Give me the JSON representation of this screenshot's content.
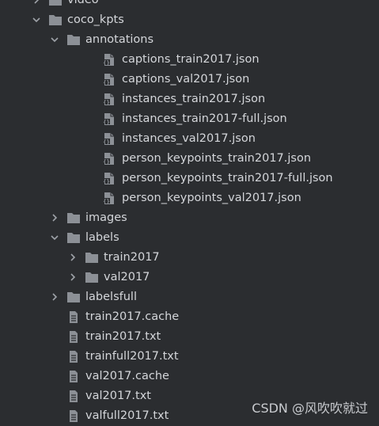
{
  "tree": [
    {
      "label": "video",
      "type": "folder",
      "depth": 1,
      "expanded": false
    },
    {
      "label": "coco_kpts",
      "type": "folder",
      "depth": 1,
      "expanded": true
    },
    {
      "label": "annotations",
      "type": "folder",
      "depth": 2,
      "expanded": true
    },
    {
      "label": "captions_train2017.json",
      "type": "json",
      "depth": 3
    },
    {
      "label": "captions_val2017.json",
      "type": "json",
      "depth": 3
    },
    {
      "label": "instances_train2017.json",
      "type": "json",
      "depth": 3
    },
    {
      "label": "instances_train2017-full.json",
      "type": "json",
      "depth": 3
    },
    {
      "label": "instances_val2017.json",
      "type": "json",
      "depth": 3
    },
    {
      "label": "person_keypoints_train2017.json",
      "type": "json",
      "depth": 3
    },
    {
      "label": "person_keypoints_train2017-full.json",
      "type": "json",
      "depth": 3
    },
    {
      "label": "person_keypoints_val2017.json",
      "type": "json",
      "depth": 3
    },
    {
      "label": "images",
      "type": "folder",
      "depth": 2,
      "expanded": false
    },
    {
      "label": "labels",
      "type": "folder",
      "depth": 2,
      "expanded": true
    },
    {
      "label": "train2017",
      "type": "folder",
      "depth": 3,
      "expanded": false
    },
    {
      "label": "val2017",
      "type": "folder",
      "depth": 3,
      "expanded": false
    },
    {
      "label": "labelsfull",
      "type": "folder",
      "depth": 2,
      "expanded": false
    },
    {
      "label": "train2017.cache",
      "type": "file",
      "depth": 2
    },
    {
      "label": "train2017.txt",
      "type": "file",
      "depth": 2
    },
    {
      "label": "trainfull2017.txt",
      "type": "file",
      "depth": 2
    },
    {
      "label": "val2017.cache",
      "type": "file",
      "depth": 2
    },
    {
      "label": "val2017.txt",
      "type": "file",
      "depth": 2
    },
    {
      "label": "valfull2017.txt",
      "type": "file",
      "depth": 2
    }
  ],
  "watermark": "CSDN @风吹吹就过",
  "colors": {
    "background": "#2b2d30",
    "text": "#d4d6da",
    "icon": "#8c9096",
    "chevron": "#9ea2a8"
  }
}
